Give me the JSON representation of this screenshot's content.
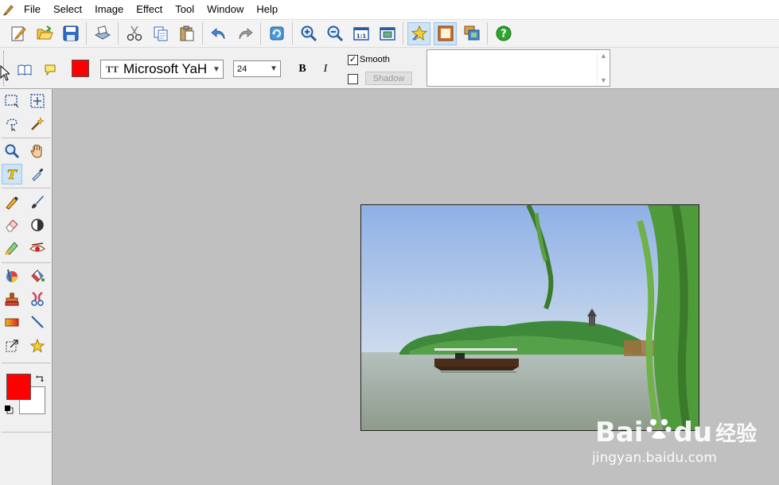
{
  "menu": {
    "items": [
      "File",
      "Select",
      "Image",
      "Effect",
      "Tool",
      "Window",
      "Help"
    ]
  },
  "toolbar": {
    "icons": [
      "new-icon",
      "open-icon",
      "save-icon",
      "scan-icon",
      "cut-icon",
      "copy-icon",
      "paste-icon",
      "undo-icon",
      "redo-icon",
      "rotate-icon",
      "zoom-in-icon",
      "zoom-out-icon",
      "actual-size-icon",
      "fit-window-icon",
      "effects-icon",
      "frame-icon",
      "layers-icon",
      "help-icon"
    ]
  },
  "text_options": {
    "text_color": "#ff0000",
    "font_name": "Microsoft YaH",
    "font_size": "24",
    "bold_label": "B",
    "italic_label": "I",
    "smooth_label": "Smooth",
    "smooth_checked": true,
    "shadow_label": "Shadow",
    "shadow_checked": false
  },
  "tools": {
    "active": "text-tool",
    "foreground_color": "#ff0000",
    "background_color": "#ffffff"
  },
  "colors": {
    "accent": "#cde4f7",
    "panel": "#f0f0f0",
    "canvas": "#c0c0c0"
  },
  "watermark": {
    "brand": "Bai",
    "brand_suffix": "du",
    "site_cn": "经验",
    "url": "jingyan.baidu.com"
  }
}
